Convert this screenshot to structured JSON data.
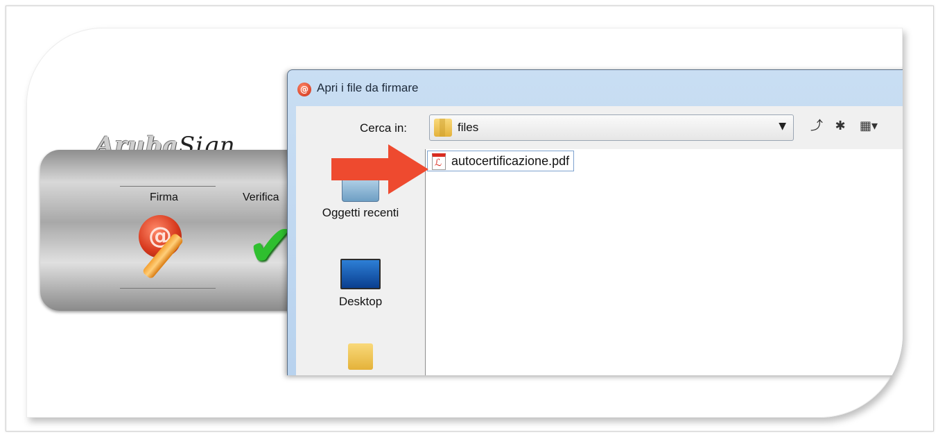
{
  "app": {
    "logo_text": "Aruba",
    "logo_script": "Sign",
    "functions": [
      {
        "label": "Firma"
      },
      {
        "label": "Verifica"
      }
    ]
  },
  "dialog": {
    "title": "Apri i file da firmare",
    "look_in_label": "Cerca in:",
    "look_in_value": "files",
    "places": [
      {
        "label": "Oggetti recenti",
        "icon": "recent-items-icon"
      },
      {
        "label": "Desktop",
        "icon": "desktop-icon"
      },
      {
        "label": "",
        "icon": "documents-folder-icon"
      }
    ],
    "files": [
      {
        "name": "autocertificazione.pdf",
        "icon": "pdf-file-icon",
        "selected": true
      }
    ]
  },
  "annotation": {
    "arrow_color": "#ee4a2f"
  }
}
